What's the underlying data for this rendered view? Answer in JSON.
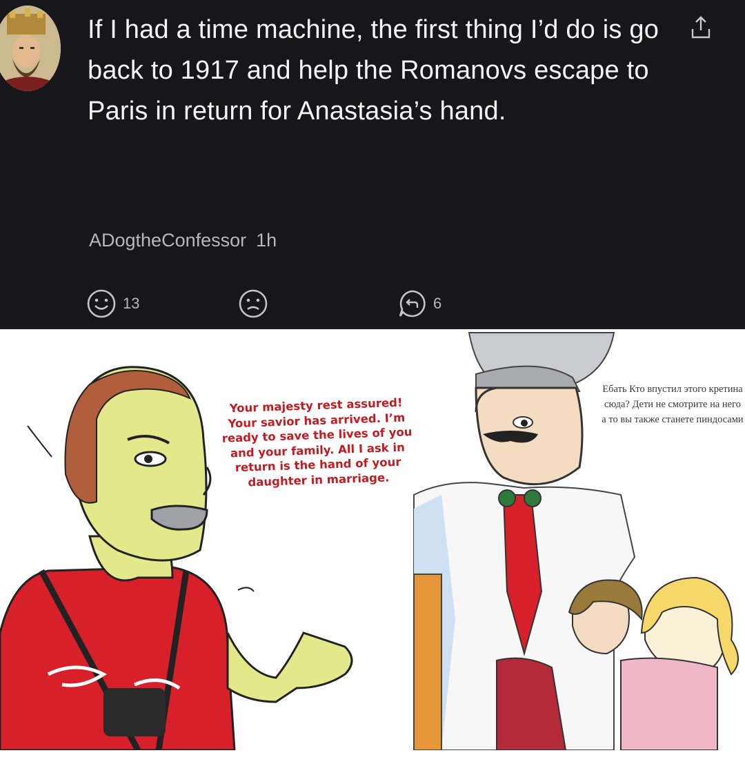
{
  "post": {
    "text": "If I had a time machine, the first thing I’d do is go back to 1917 and help the Romanovs escape to Paris in return for Anastasia’s hand.",
    "username": "ADogtheConfessor",
    "time": "1h",
    "likes": "13",
    "replies": "6"
  },
  "icons": {
    "share": "share-icon",
    "like": "smiley-icon",
    "dislike": "frown-icon",
    "reply": "reply-icon"
  },
  "comic": {
    "left_bubble": "Your majesty rest assured! Your savior has arrived. I’m ready to save the lives of you and your family. All I ask in return is the hand of your daughter in marriage.",
    "right_bubble": "Ебать Кто впустил этого кретина сюда? Дети не смотрите на него а то вы также станете пиндосами"
  },
  "colors": {
    "post_bg": "#16161b",
    "post_text": "#f5f5f5",
    "meta_text": "#b8b8bd",
    "bubble_red": "#c21b22"
  }
}
